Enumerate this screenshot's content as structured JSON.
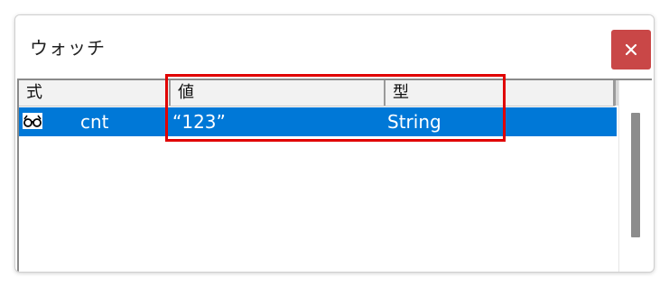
{
  "window": {
    "title": "ウォッチ",
    "close_icon": "close-icon"
  },
  "columns": [
    {
      "label": "式"
    },
    {
      "label": "値"
    },
    {
      "label": "型"
    }
  ],
  "rows": [
    {
      "icon": "glasses-icon",
      "expression": "cnt",
      "value": "“123”",
      "type": "String",
      "selected": true
    }
  ],
  "colors": {
    "selection": "#0078d7",
    "close_button": "#c94747",
    "highlight": "#e00000"
  }
}
